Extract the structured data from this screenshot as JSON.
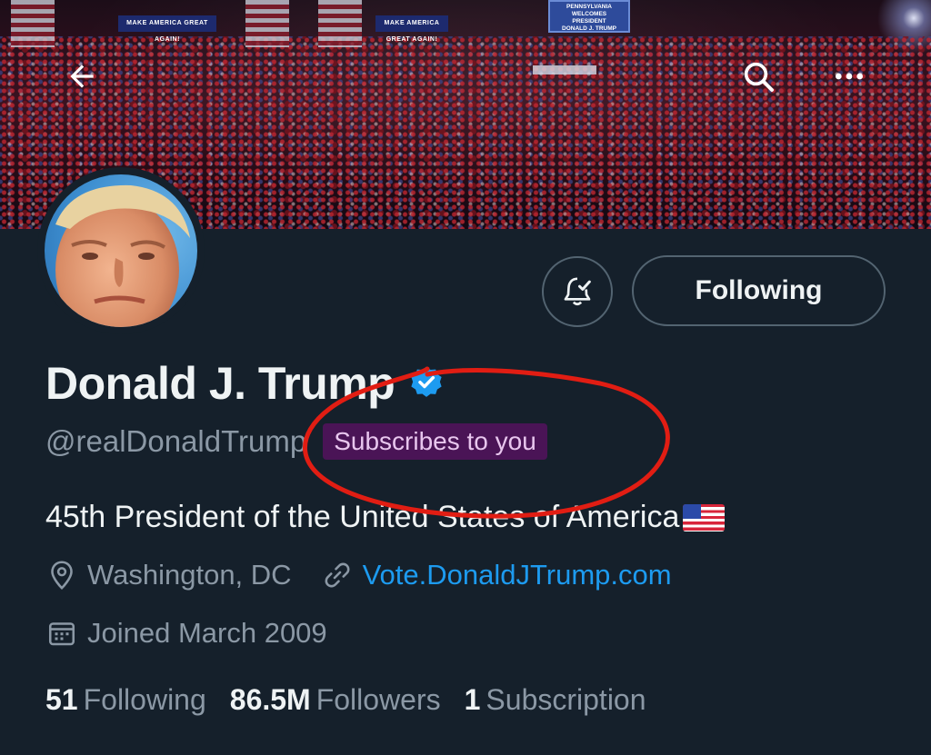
{
  "banner": {
    "sign_left": "MAKE AMERICA GREAT AGAIN!",
    "sign_mid": "MAKE AMERICA GREAT AGAIN!",
    "board_lines": [
      "PENNSYLVANIA",
      "WELCOMES",
      "PRESIDENT",
      "DONALD J. TRUMP"
    ]
  },
  "header": {
    "back_icon": "arrow-left-icon",
    "search_icon": "search-icon",
    "more_icon": "more-dots-icon"
  },
  "profile": {
    "display_name": "Donald J. Trump",
    "verified": true,
    "handle": "@realDonaldTrump",
    "subscribes_badge": "Subscribes to you",
    "bio": "45th President of the United States of America",
    "location": "Washington, DC",
    "website": "Vote.DonaldJTrump.com",
    "joined": "Joined March 2009"
  },
  "actions": {
    "notify_icon": "bell-check-icon",
    "following_label": "Following"
  },
  "stats": [
    {
      "num": "51",
      "label": "Following"
    },
    {
      "num": "86.5M",
      "label": "Followers"
    },
    {
      "num": "1",
      "label": "Subscription"
    }
  ],
  "colors": {
    "background": "#15202b",
    "accent_blue": "#1d9bf0",
    "muted_text": "#8b98a5",
    "badge_bg": "#4a1456",
    "badge_text": "#e8c6ee",
    "annotation_red": "#e11d13"
  }
}
